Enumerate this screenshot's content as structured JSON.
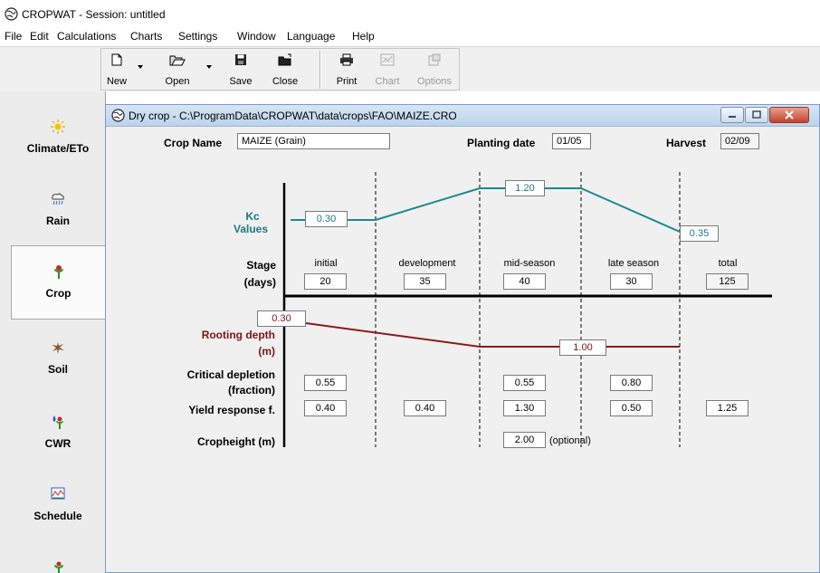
{
  "app": {
    "title": "CROPWAT - Session: untitled",
    "icon": "cropwat-globe-icon"
  },
  "menu": [
    "File",
    "Edit",
    "Calculations",
    "Charts",
    "Settings",
    "Window",
    "Language",
    "Help"
  ],
  "toolbar": {
    "new": "New",
    "open": "Open",
    "save": "Save",
    "close": "Close",
    "print": "Print",
    "chart": "Chart",
    "options": "Options"
  },
  "sidebar": {
    "items": [
      {
        "label": "Climate/ETo",
        "icon": "sun-icon"
      },
      {
        "label": "Rain",
        "icon": "rain-cloud-icon"
      },
      {
        "label": "Crop",
        "icon": "plant-icon"
      },
      {
        "label": "Soil",
        "icon": "soil-icon"
      },
      {
        "label": "CWR",
        "icon": "water-drop-plant-icon"
      },
      {
        "label": "Schedule",
        "icon": "schedule-chart-icon"
      }
    ],
    "active": "Crop"
  },
  "window": {
    "title": "Dry crop - C:\\ProgramData\\CROPWAT\\data\\crops\\FAO\\MAIZE.CRO"
  },
  "crop": {
    "name_label": "Crop Name",
    "name": "MAIZE  (Grain)",
    "planting_label": "Planting date",
    "planting": "01/05",
    "harvest_label": "Harvest",
    "harvest": "02/09"
  },
  "labels": {
    "kc": "Kc",
    "values": "Values",
    "stage": "Stage",
    "days": "(days)",
    "rooting": "Rooting depth",
    "m": "(m)",
    "critical": "Critical depletion",
    "fraction": "(fraction)",
    "yield": "Yield response f.",
    "cropheight": "Cropheight (m)",
    "optional": "(optional)"
  },
  "stages": [
    "initial",
    "development",
    "mid-season",
    "late season",
    "total"
  ],
  "days": [
    "20",
    "35",
    "40",
    "30",
    "125"
  ],
  "kc": {
    "initial": "0.30",
    "mid": "1.20",
    "end": "0.35"
  },
  "rooting": {
    "initial": "0.30",
    "max": "1.00"
  },
  "critical_depletion": {
    "initial": "0.55",
    "mid": "0.55",
    "late": "0.80"
  },
  "yield_response": [
    "0.40",
    "0.40",
    "1.30",
    "0.50",
    "1.25"
  ],
  "cropheight": "2.00",
  "colors": {
    "kc_line": "#1b8a8f",
    "root_line": "#8b1a1a"
  }
}
